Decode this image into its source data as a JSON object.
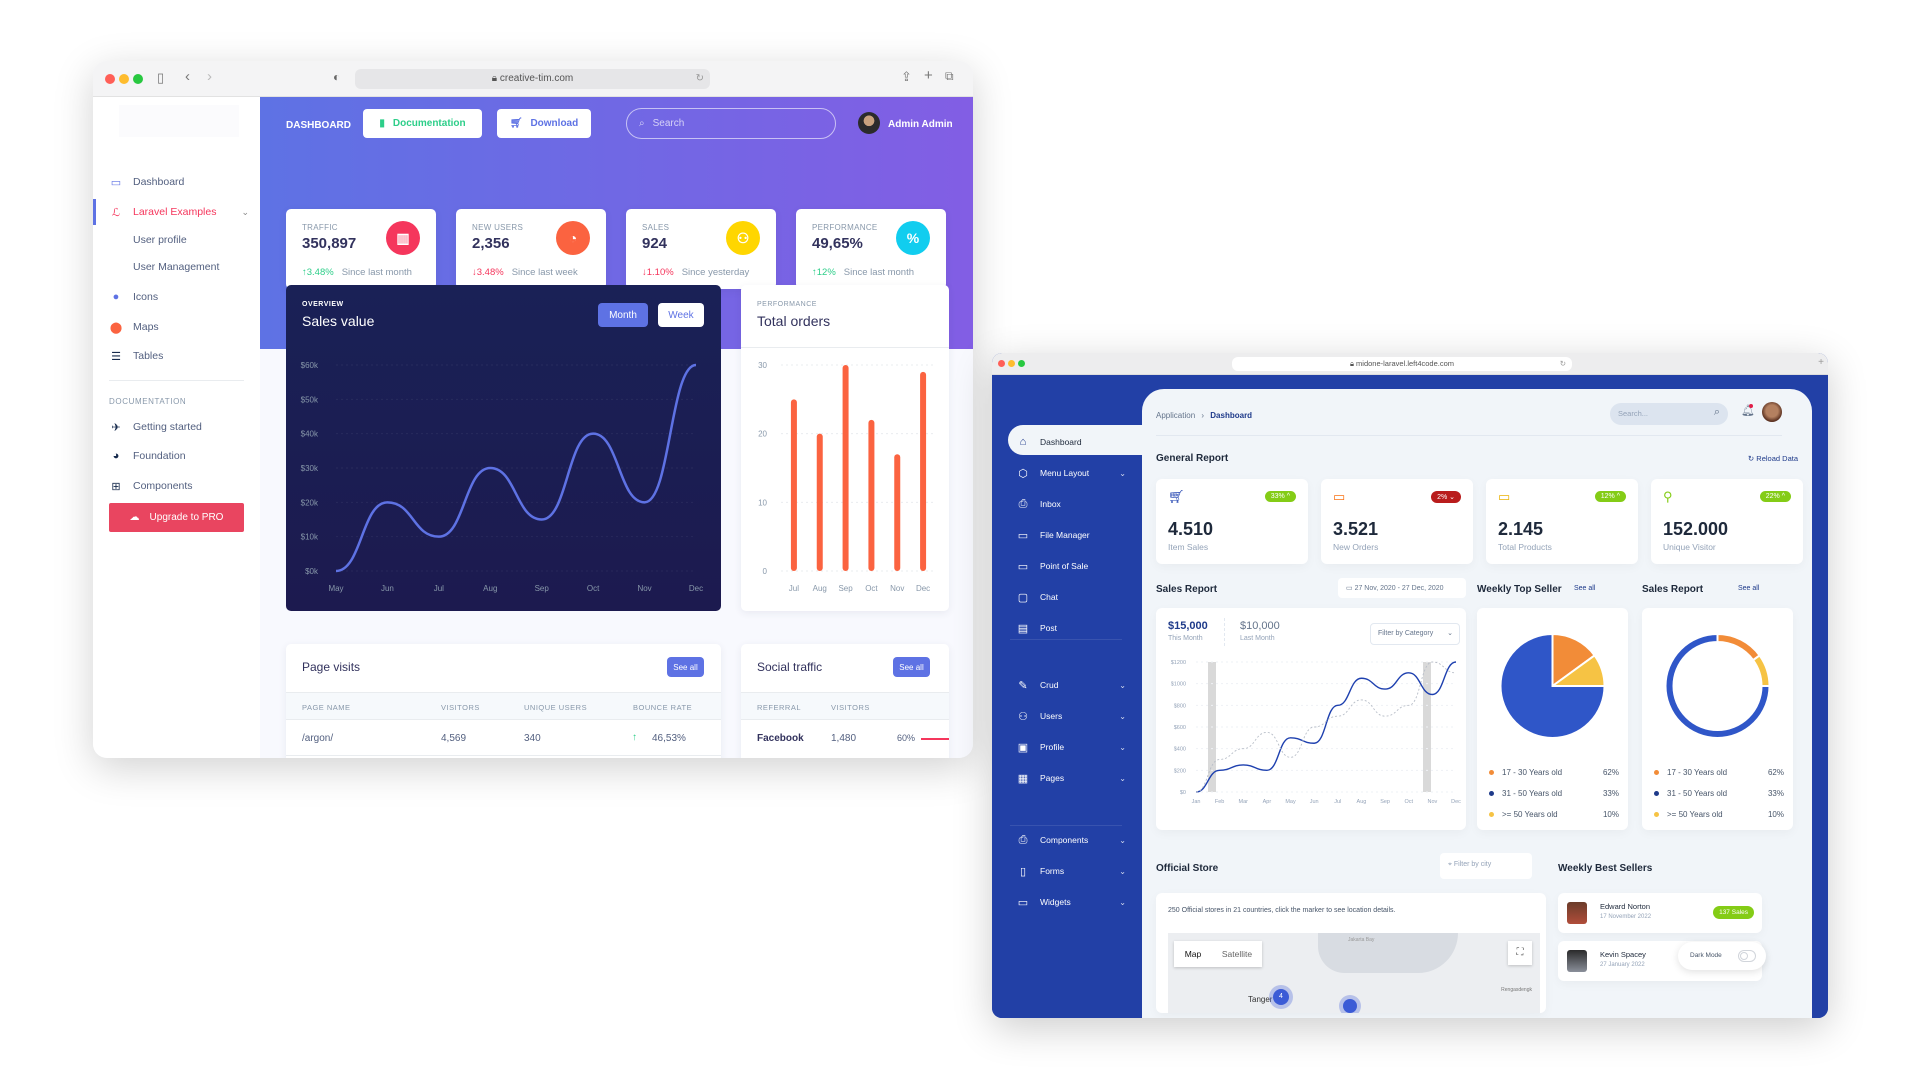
{
  "window1": {
    "url": "creative-tim.com",
    "sidebar": {
      "items": [
        {
          "label": "Dashboard",
          "icon": "monitor-icon"
        },
        {
          "label": "Laravel Examples",
          "icon": "laravel-icon",
          "active": true
        },
        {
          "label": "User profile"
        },
        {
          "label": "User Management"
        },
        {
          "label": "Icons",
          "icon": "planet-icon"
        },
        {
          "label": "Maps",
          "icon": "pin-icon"
        },
        {
          "label": "Tables",
          "icon": "list-icon"
        }
      ],
      "section_heading": "DOCUMENTATION",
      "doc_items": [
        {
          "label": "Getting started",
          "icon": "spaceship-icon"
        },
        {
          "label": "Foundation",
          "icon": "palette-icon"
        },
        {
          "label": "Components",
          "icon": "ui-icon"
        }
      ],
      "upgrade_label": "Upgrade to PRO"
    },
    "header": {
      "title": "DASHBOARD",
      "documentation_label": "Documentation",
      "download_label": "Download",
      "search_placeholder": "Search",
      "user_name": "Admin Admin"
    },
    "stats": [
      {
        "title": "TRAFFIC",
        "value": "350,897",
        "change": "3.48%",
        "direction": "up",
        "since": "Since last month",
        "color": "#f5365c"
      },
      {
        "title": "NEW USERS",
        "value": "2,356",
        "change": "3.48%",
        "direction": "down",
        "since": "Since last week",
        "color": "#fb6340"
      },
      {
        "title": "SALES",
        "value": "924",
        "change": "1.10%",
        "direction": "down",
        "since": "Since yesterday",
        "color": "#ffd600"
      },
      {
        "title": "PERFORMANCE",
        "value": "49,65%",
        "change": "12%",
        "direction": "up",
        "since": "Since last month",
        "color": "#11cdef"
      }
    ],
    "sales_card": {
      "overline": "OVERVIEW",
      "title": "Sales value",
      "month_label": "Month",
      "week_label": "Week"
    },
    "orders_card": {
      "overline": "PERFORMANCE",
      "title": "Total orders"
    },
    "page_visits": {
      "title": "Page visits",
      "see_all": "See all",
      "columns": [
        "PAGE NAME",
        "VISITORS",
        "UNIQUE USERS",
        "BOUNCE RATE"
      ],
      "rows": [
        [
          "/argon/",
          "4,569",
          "340",
          "46,53%"
        ]
      ]
    },
    "social_traffic": {
      "title": "Social traffic",
      "see_all": "See all",
      "columns": [
        "REFERRAL",
        "VISITORS"
      ],
      "rows": [
        [
          "Facebook",
          "1,480",
          "60%"
        ]
      ]
    }
  },
  "window2": {
    "url": "midone-laravel.left4code.com",
    "breadcrumb": {
      "parent": "Application",
      "current": "Dashboard"
    },
    "search_placeholder": "Search...",
    "nav": [
      {
        "label": "Dashboard",
        "icon": "home-icon",
        "active": true
      },
      {
        "label": "Menu Layout",
        "icon": "box-icon",
        "chevron": true
      },
      {
        "label": "Inbox",
        "icon": "inbox-icon"
      },
      {
        "label": "File Manager",
        "icon": "hard-drive-icon"
      },
      {
        "label": "Point of Sale",
        "icon": "credit-card-icon"
      },
      {
        "label": "Chat",
        "icon": "message-square-icon"
      },
      {
        "label": "Post",
        "icon": "file-text-icon"
      },
      {
        "label": "Crud",
        "icon": "edit-icon",
        "chevron": true
      },
      {
        "label": "Users",
        "icon": "users-icon",
        "chevron": true
      },
      {
        "label": "Profile",
        "icon": "trello-icon",
        "chevron": true
      },
      {
        "label": "Pages",
        "icon": "layout-icon",
        "chevron": true
      },
      {
        "label": "Components",
        "icon": "inbox-icon",
        "chevron": true
      },
      {
        "label": "Forms",
        "icon": "sidebar-icon",
        "chevron": true
      },
      {
        "label": "Widgets",
        "icon": "hard-drive-icon",
        "chevron": true
      }
    ],
    "general_report": {
      "title": "General Report",
      "reload_label": "Reload Data",
      "cards": [
        {
          "value": "4.510",
          "label": "Item Sales",
          "badge": "33%",
          "trend": "up",
          "badge_color": "#84cc16",
          "icon_color": "#1e40af"
        },
        {
          "value": "3.521",
          "label": "New Orders",
          "badge": "2%",
          "trend": "down",
          "badge_color": "#b91c1c",
          "icon_color": "#f97316"
        },
        {
          "value": "2.145",
          "label": "Total Products",
          "badge": "12%",
          "trend": "up",
          "badge_color": "#84cc16",
          "icon_color": "#eab308"
        },
        {
          "value": "152.000",
          "label": "Unique Visitor",
          "badge": "22%",
          "trend": "up",
          "badge_color": "#84cc16",
          "icon_color": "#84cc16"
        }
      ]
    },
    "sales_report": {
      "title": "Sales Report",
      "date_range": "27 Nov, 2020 - 27 Dec, 2020",
      "this_month_value": "$15,000",
      "this_month_label": "This Month",
      "last_month_value": "$10,000",
      "last_month_label": "Last Month",
      "filter_label": "Filter by Category"
    },
    "weekly_top_seller": {
      "title": "Weekly Top Seller",
      "see_all": "See all"
    },
    "sales_report_2": {
      "title": "Sales Report",
      "see_all": "See all"
    },
    "legend": [
      {
        "label": "17 - 30 Years old",
        "value": "62%",
        "color": "#f28c38"
      },
      {
        "label": "31 - 50 Years old",
        "value": "33%",
        "color": "#1e3a8a"
      },
      {
        "label": ">= 50 Years old",
        "value": "10%",
        "color": "#f6c344"
      }
    ],
    "official_store": {
      "title": "Official Store",
      "filter_placeholder": "Filter by city",
      "description": "250 Official stores in 21 countries, click the marker to see location details.",
      "map_tab": "Map",
      "satellite_tab": "Satellite",
      "map_labels": [
        "Jakarta Bay",
        "Tanger",
        "Rengasdengk"
      ],
      "cluster_count": "4"
    },
    "best_sellers": {
      "title": "Weekly Best Sellers",
      "items": [
        {
          "name": "Edward Norton",
          "date": "17 November 2022",
          "badge": "137 Sales"
        },
        {
          "name": "Kevin Spacey",
          "date": "27 January 2022"
        }
      ],
      "dark_mode_label": "Dark Mode"
    }
  },
  "chart_data": [
    {
      "type": "line",
      "title": "Sales value",
      "categories": [
        "May",
        "Jun",
        "Jul",
        "Aug",
        "Sep",
        "Oct",
        "Nov",
        "Dec"
      ],
      "series": [
        {
          "name": "Sales",
          "values": [
            0,
            20,
            10,
            30,
            15,
            40,
            20,
            60
          ]
        }
      ],
      "yticks": [
        "$0k",
        "$10k",
        "$20k",
        "$30k",
        "$40k",
        "$50k",
        "$60k"
      ],
      "ylim": [
        0,
        60
      ],
      "grid": true
    },
    {
      "type": "bar",
      "title": "Total orders",
      "categories": [
        "Jul",
        "Aug",
        "Sep",
        "Oct",
        "Nov",
        "Dec"
      ],
      "values": [
        25,
        20,
        30,
        22,
        17,
        29
      ],
      "yticks": [
        "0",
        "10",
        "20",
        "30"
      ],
      "ylim": [
        0,
        30
      ],
      "grid": true
    },
    {
      "type": "line",
      "title": "Sales Report",
      "categories": [
        "Jan",
        "Feb",
        "Mar",
        "Apr",
        "May",
        "Jun",
        "Jul",
        "Aug",
        "Sep",
        "Oct",
        "Nov",
        "Dec"
      ],
      "series": [
        {
          "name": "This Month",
          "values": [
            0,
            200,
            250,
            200,
            500,
            450,
            800,
            1050,
            950,
            1100,
            900,
            1200
          ]
        },
        {
          "name": "Last Month",
          "values": [
            0,
            300,
            400,
            550,
            320,
            600,
            700,
            850,
            700,
            800,
            1200,
            1100
          ]
        }
      ],
      "yticks": [
        "$0",
        "$200",
        "$400",
        "$600",
        "$800",
        "$1000",
        "$1200"
      ],
      "ylim": [
        0,
        1200
      ],
      "grid": true
    },
    {
      "type": "pie",
      "title": "Weekly Top Seller",
      "labels": [
        "17 - 30 Years old",
        ">= 50 Years old",
        "31 - 50 Years old"
      ],
      "values": [
        15,
        10,
        75
      ]
    },
    {
      "type": "pie",
      "title": "Sales Report (donut)",
      "labels": [
        "17 - 30 Years old",
        ">= 50 Years old",
        "31 - 50 Years old"
      ],
      "values": [
        15,
        10,
        75
      ]
    }
  ]
}
